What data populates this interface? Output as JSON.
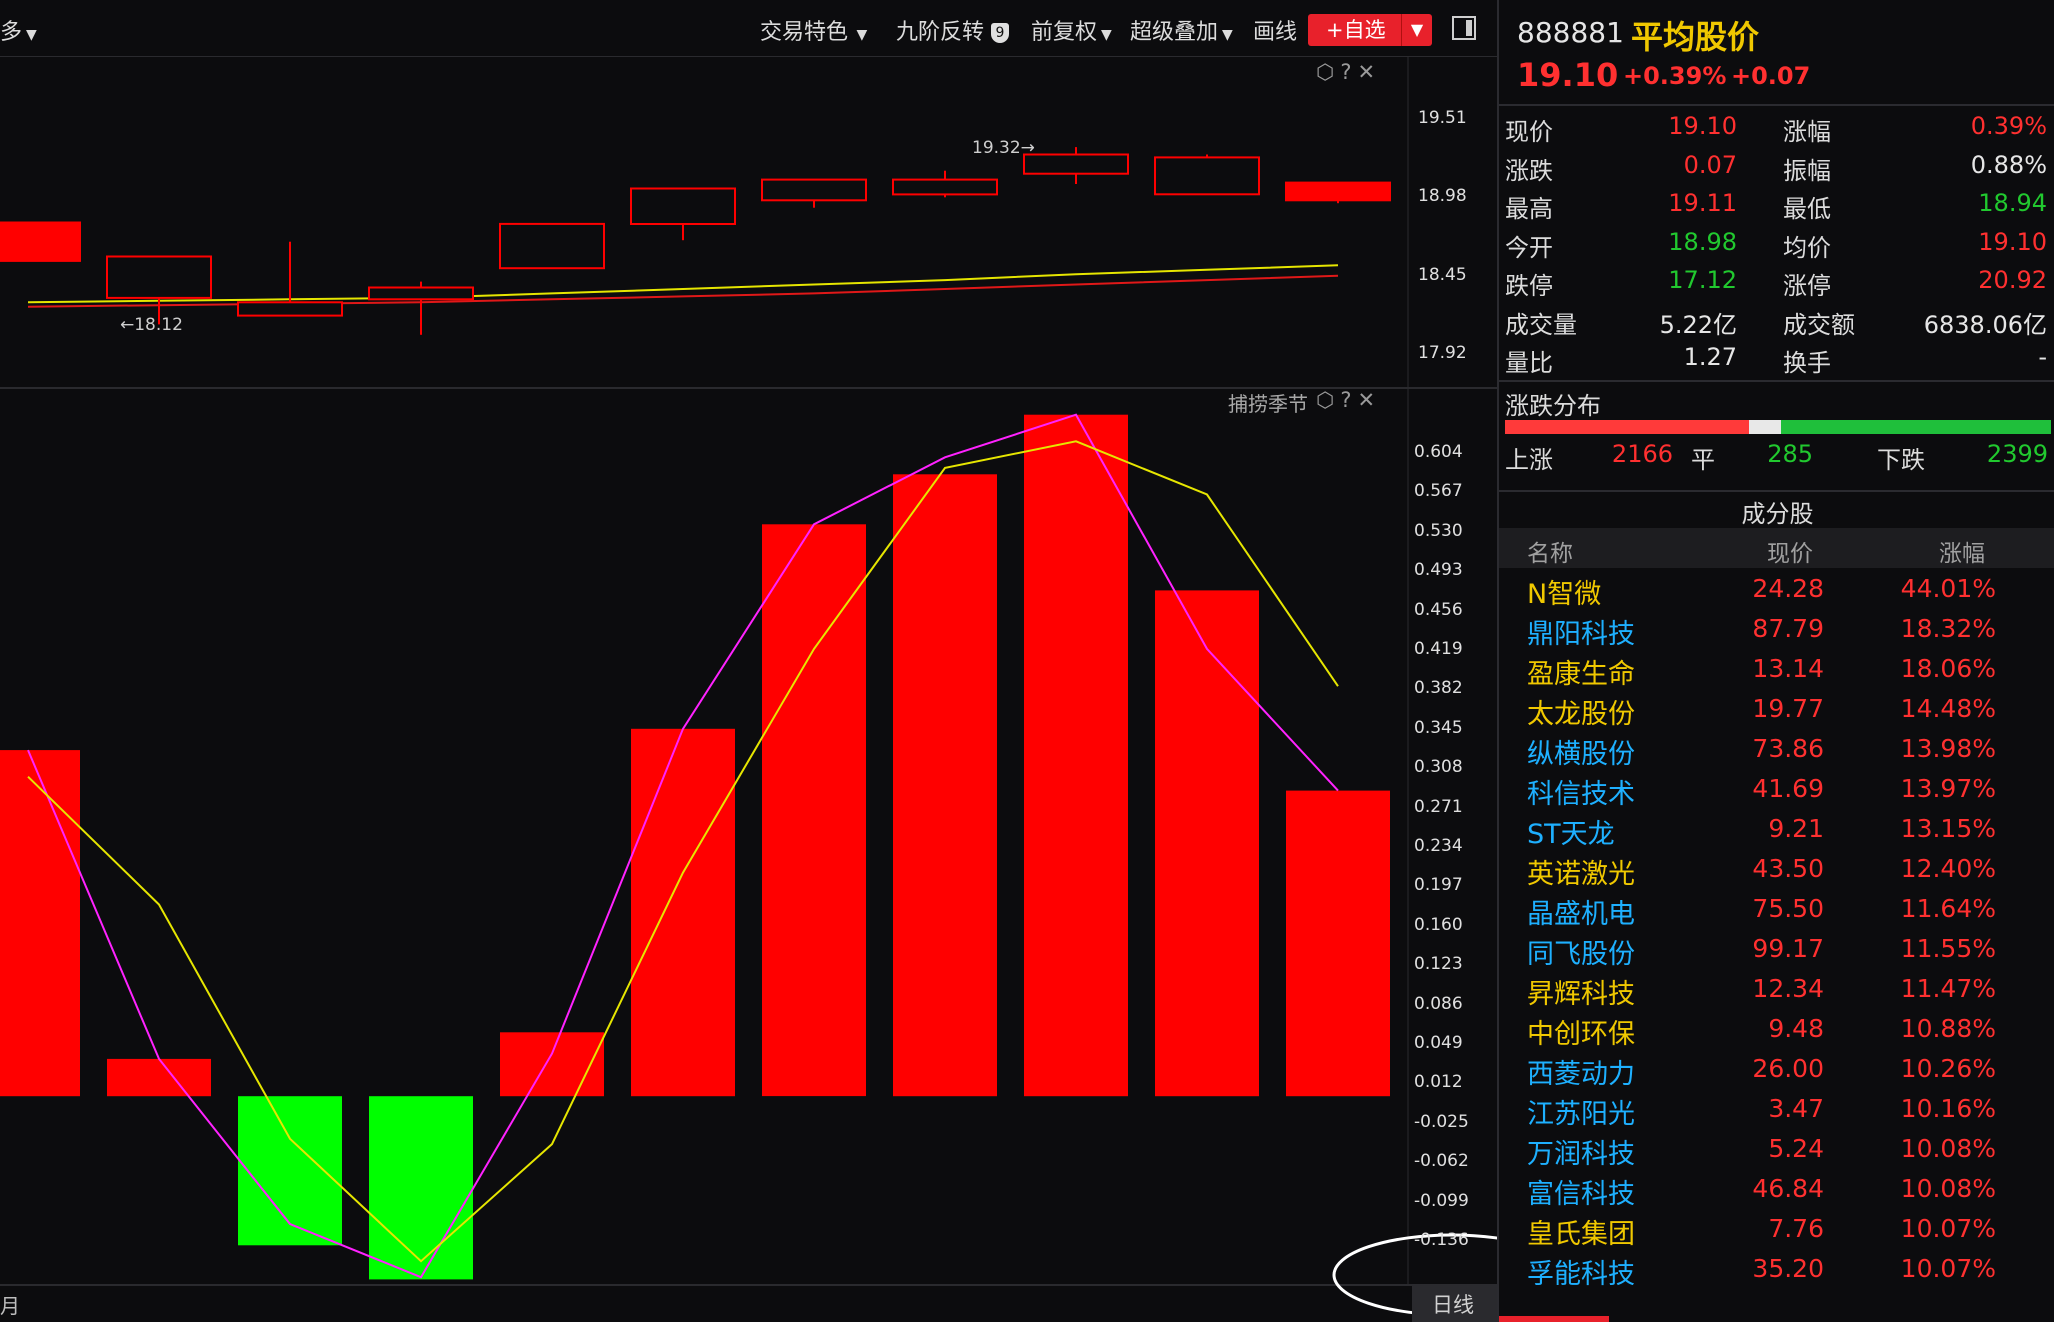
{
  "toolbar": {
    "left_label": "多",
    "items": [
      "交易特色",
      "九阶反转",
      "前复权",
      "超级叠加",
      "画线"
    ],
    "nine_badge": "9",
    "add_favorite": "+自选"
  },
  "main_chart": {
    "axis_ticks": [
      "19.51",
      "18.98",
      "18.45",
      "17.92"
    ],
    "high_annotation": "19.32→",
    "low_annotation": "←18.12",
    "candles": [
      {
        "open": 18.81,
        "close": 18.55,
        "high": 18.81,
        "low": 18.55
      },
      {
        "open": 18.3,
        "close": 18.58,
        "high": 18.58,
        "low": 18.12
      },
      {
        "open": 18.18,
        "close": 18.27,
        "high": 18.68,
        "low": 18.18
      },
      {
        "open": 18.29,
        "close": 18.37,
        "high": 18.41,
        "low": 18.05
      },
      {
        "open": 18.5,
        "close": 18.8,
        "high": 18.8,
        "low": 18.5
      },
      {
        "open": 18.8,
        "close": 19.04,
        "high": 19.04,
        "low": 18.69
      },
      {
        "open": 18.96,
        "close": 19.1,
        "high": 19.1,
        "low": 18.91
      },
      {
        "open": 19.0,
        "close": 19.1,
        "high": 19.16,
        "low": 18.98
      },
      {
        "open": 19.14,
        "close": 19.27,
        "high": 19.32,
        "low": 19.07
      },
      {
        "open": 19.0,
        "close": 19.25,
        "high": 19.27,
        "low": 19.0
      },
      {
        "open": 19.08,
        "close": 18.96,
        "high": 19.08,
        "low": 18.94
      }
    ],
    "ma_yellow": [
      18.27,
      18.28,
      18.29,
      18.3,
      18.33,
      18.36,
      18.39,
      18.42,
      18.46,
      18.49,
      18.52
    ],
    "ma_red": [
      18.24,
      18.25,
      18.26,
      18.27,
      18.29,
      18.31,
      18.33,
      18.36,
      18.39,
      18.42,
      18.45
    ]
  },
  "indicator": {
    "name": "捕捞季节",
    "axis_ticks": [
      "0.604",
      "0.567",
      "0.530",
      "0.493",
      "0.456",
      "0.419",
      "0.382",
      "0.345",
      "0.308",
      "0.271",
      "0.234",
      "0.197",
      "0.160",
      "0.123",
      "0.086",
      "0.049",
      "0.012",
      "-0.025",
      "-0.062",
      "-0.099",
      "-0.136"
    ],
    "bars": [
      0.325,
      0.035,
      -0.14,
      -0.172,
      0.06,
      0.345,
      0.537,
      0.584,
      0.64,
      0.475,
      0.287
    ],
    "magenta_line": [
      0.325,
      0.035,
      -0.12,
      -0.17,
      0.04,
      0.345,
      0.537,
      0.6,
      0.64,
      0.42,
      0.287
    ],
    "yellow_line": [
      0.3,
      0.18,
      -0.04,
      -0.155,
      -0.045,
      0.21,
      0.42,
      0.59,
      0.615,
      0.565,
      0.385
    ],
    "period_label": "日线",
    "bottom_left": "月"
  },
  "quote": {
    "code": "888881",
    "name": "平均股价",
    "price": "19.10",
    "change_pct": "+0.39%",
    "change": "+0.07",
    "fields": [
      {
        "l1": "现价",
        "v1": "19.10",
        "c1": "red",
        "l2": "涨幅",
        "v2": "0.39%",
        "c2": "red"
      },
      {
        "l1": "涨跌",
        "v1": "0.07",
        "c1": "red",
        "l2": "振幅",
        "v2": "0.88%",
        "c2": "white"
      },
      {
        "l1": "最高",
        "v1": "19.11",
        "c1": "red",
        "l2": "最低",
        "v2": "18.94",
        "c2": "green"
      },
      {
        "l1": "今开",
        "v1": "18.98",
        "c1": "green",
        "l2": "均价",
        "v2": "19.10",
        "c2": "red"
      },
      {
        "l1": "跌停",
        "v1": "17.12",
        "c1": "green",
        "l2": "涨停",
        "v2": "20.92",
        "c2": "red"
      },
      {
        "l1": "成交量",
        "v1": "5.22亿",
        "c1": "white",
        "l2": "成交额",
        "v2": "6838.06亿",
        "c2": "white"
      },
      {
        "l1": "量比",
        "v1": "1.27",
        "c1": "white",
        "l2": "换手",
        "v2": "-",
        "c2": "white"
      }
    ]
  },
  "breadth": {
    "title": "涨跌分布",
    "up_label": "上涨",
    "up": "2166",
    "flat_label": "平",
    "flat": "285",
    "down_label": "下跌",
    "down": "2399",
    "up_count": 2166,
    "flat_count": 285,
    "down_count": 2399
  },
  "constituents": {
    "title": "成分股",
    "headers": [
      "名称",
      "现价",
      "涨幅"
    ],
    "rows": [
      {
        "name": "N智微",
        "price": "24.28",
        "pct": "44.01%",
        "color": "yellow"
      },
      {
        "name": "鼎阳科技",
        "price": "87.79",
        "pct": "18.32%",
        "color": "cyan"
      },
      {
        "name": "盈康生命",
        "price": "13.14",
        "pct": "18.06%",
        "color": "yellow"
      },
      {
        "name": "太龙股份",
        "price": "19.77",
        "pct": "14.48%",
        "color": "yellow"
      },
      {
        "name": "纵横股份",
        "price": "73.86",
        "pct": "13.98%",
        "color": "cyan"
      },
      {
        "name": "科信技术",
        "price": "41.69",
        "pct": "13.97%",
        "color": "cyan"
      },
      {
        "name": "ST天龙",
        "price": "9.21",
        "pct": "13.15%",
        "color": "cyan"
      },
      {
        "name": "英诺激光",
        "price": "43.50",
        "pct": "12.40%",
        "color": "yellow"
      },
      {
        "name": "晶盛机电",
        "price": "75.50",
        "pct": "11.64%",
        "color": "cyan"
      },
      {
        "name": "同飞股份",
        "price": "99.17",
        "pct": "11.55%",
        "color": "cyan"
      },
      {
        "name": "昇辉科技",
        "price": "12.34",
        "pct": "11.47%",
        "color": "yellow"
      },
      {
        "name": "中创环保",
        "price": "9.48",
        "pct": "10.88%",
        "color": "yellow"
      },
      {
        "name": "西菱动力",
        "price": "26.00",
        "pct": "10.26%",
        "color": "cyan"
      },
      {
        "name": "江苏阳光",
        "price": "3.47",
        "pct": "10.16%",
        "color": "cyan"
      },
      {
        "name": "万润科技",
        "price": "5.24",
        "pct": "10.08%",
        "color": "cyan"
      },
      {
        "name": "富信科技",
        "price": "46.84",
        "pct": "10.08%",
        "color": "cyan"
      },
      {
        "name": "皇氏集团",
        "price": "7.76",
        "pct": "10.07%",
        "color": "yellow"
      },
      {
        "name": "孚能科技",
        "price": "35.20",
        "pct": "10.07%",
        "color": "cyan"
      }
    ]
  },
  "colors": {
    "up": "#ff0000",
    "down": "#00ff00",
    "ma_yellow": "#e6e600",
    "ma_red": "#e01818",
    "magenta": "#ff22ff",
    "background": "#0c0c0e"
  }
}
